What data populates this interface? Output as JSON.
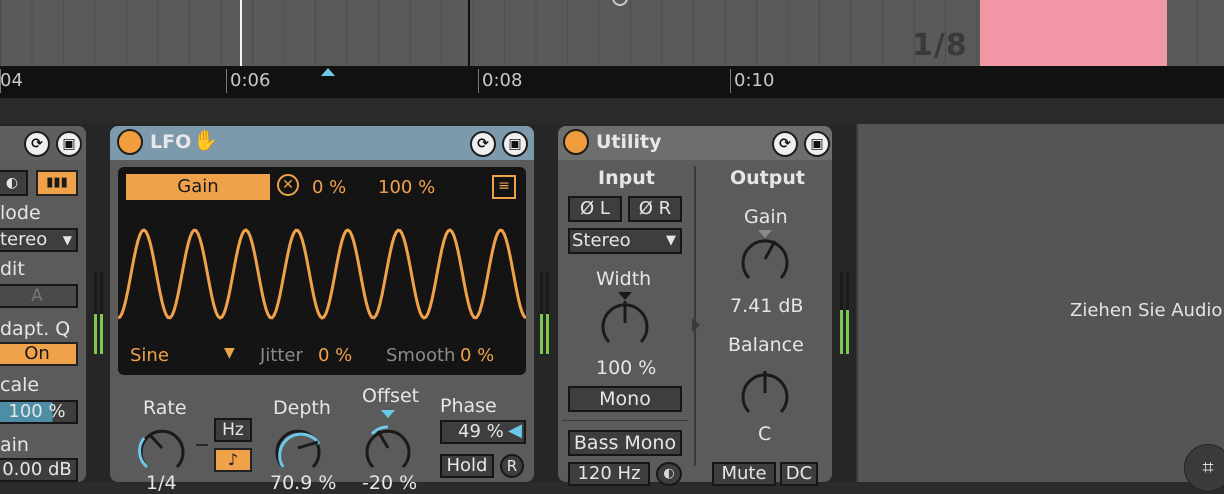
{
  "arrangement": {
    "grid_label": "1/8",
    "clip_color": "#f197a6",
    "ruler": {
      "labels": [
        "04",
        "0:06",
        "0:08",
        "0:10"
      ]
    }
  },
  "left_device": {
    "mode_label": "lode",
    "mode_value": "tereo",
    "edit_label": "dit",
    "edit_value": "A",
    "adapt_label": "dapt. Q",
    "adapt_value": "On",
    "scale_label": "cale",
    "scale_value": "100 %",
    "gain_label": "ain",
    "gain_value": "0.00 dB"
  },
  "lfo": {
    "title": "LFO",
    "target": "Gain",
    "min": "0 %",
    "max": "100 %",
    "shape": "Sine",
    "jitter_label": "Jitter",
    "jitter_value": "0 %",
    "smooth_label": "Smooth",
    "smooth_value": "0 %",
    "rate_label": "Rate",
    "rate_value": "1/4",
    "hz_label": "Hz",
    "depth_label": "Depth",
    "depth_value": "70.9 %",
    "offset_label": "Offset",
    "offset_value": "-20 %",
    "phase_label": "Phase",
    "phase_value": "49 %",
    "hold_label": "Hold",
    "r_label": "R",
    "colors": {
      "accent": "#f0a24a",
      "header": "#7c9aab",
      "knob_arc": "#6cc7e8"
    }
  },
  "utility": {
    "title": "Utility",
    "input_label": "Input",
    "phase_l": "Ø L",
    "phase_r": "Ø R",
    "channel_mode": "Stereo",
    "width_label": "Width",
    "width_value": "100 %",
    "mono_label": "Mono",
    "bass_mono_label": "Bass Mono",
    "bass_freq": "120 Hz",
    "output_label": "Output",
    "gain_label": "Gain",
    "gain_value": "7.41 dB",
    "balance_label": "Balance",
    "balance_value": "C",
    "mute_label": "Mute",
    "dc_label": "DC"
  },
  "drop_area": {
    "text": "Ziehen Sie Audio"
  }
}
